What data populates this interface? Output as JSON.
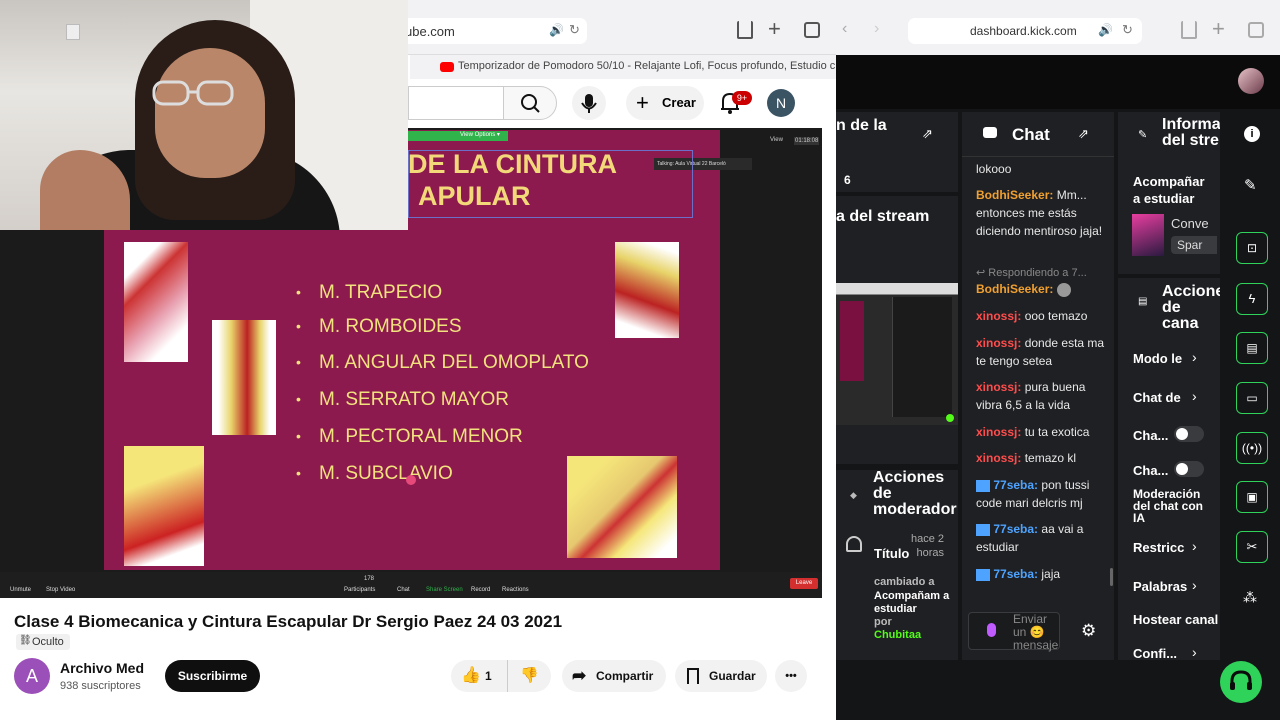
{
  "yt": {
    "url": "ube.com",
    "tab_title": "Temporizador de Pomodoro 50/10 - Relajante Lofi, Focus profundo, Estudio c...",
    "create_label": "Crear",
    "notif_count": "9+",
    "avatar_letter": "N",
    "video_title": "Clase 4 Biomecanica y Cintura Escapular Dr Sergio Paez 24 03 2021",
    "visibility": "Oculto",
    "channel_name": "Archivo Med",
    "channel_avatar_letter": "A",
    "subscribers": "938 suscriptores",
    "subscribe_label": "Suscribirme",
    "like_count": "1",
    "share_label": "Compartir",
    "save_label": "Guardar",
    "more": "•••"
  },
  "slide": {
    "title_line1": "DE LA CINTURA",
    "title_line2": "APULAR",
    "bullets": [
      "M. TRAPECIO",
      "M. ROMBOIDES",
      "M. ANGULAR DEL OMOPLATO",
      "M. SERRATO MAYOR",
      "M. PECTORAL MENOR",
      "M. SUBCLAVIO"
    ],
    "talking_text": "Talking: Aula Virtual 22 Barceló",
    "view_options": "View Options ▾",
    "zoom_controls": [
      "Unmute",
      "Stop Video",
      "Participants",
      "Chat",
      "Share Screen",
      "Record",
      "Reactions"
    ],
    "participants_count": "178",
    "leave_label": "Leave",
    "top_view": "View",
    "timer": "01:18:08"
  },
  "kick": {
    "url": "dashboard.kick.com",
    "panel_left_title": "n de la",
    "panel_left_value": "6",
    "panel_left_title2": "a del stream",
    "chat_title": "Chat",
    "chat_messages": [
      {
        "user": "",
        "text": "lokooo"
      },
      {
        "user": "BodhiSeeker",
        "text": "Mm... entonces me estás diciendo mentiroso jaja!"
      },
      {
        "user": "",
        "text": "Respondiendo a 7..."
      },
      {
        "user": "BodhiSeeker",
        "text": ""
      },
      {
        "user": "xinossj",
        "text": "ooo temazo"
      },
      {
        "user": "xinossj",
        "text": "donde esta ma te tengo setea"
      },
      {
        "user": "xinossj",
        "text": "pura buena vibra 6,5 a la vida"
      },
      {
        "user": "xinossj",
        "text": "tu ta exotica"
      },
      {
        "user": "xinossj",
        "text": "temazo kl"
      },
      {
        "user": "77seba",
        "text": "pon tussi code mari delcris mj"
      },
      {
        "user": "77seba",
        "text": "aa vai a estudiar"
      },
      {
        "user": "77seba",
        "text": "jaja"
      }
    ],
    "send_placeholder": "Enviar un 😊 mensaje",
    "info_title": "Informa del stre",
    "category": "Acompañar a estudiar",
    "conv_label": "Conve",
    "spar_label": "Spar",
    "actions_title": "Accione de cana",
    "action_items": [
      "Modo le",
      "Chat de",
      "Cha...",
      "Cha...",
      "Moderación del chat con IA",
      "Restricc",
      "Palabras",
      "Hostear canal",
      "Confi..."
    ],
    "mod_actions_title": "Acciones de moderador",
    "mod_title_label": "Título",
    "mod_time": "hace 2 horas",
    "mod_changed": "cambiado a",
    "mod_new_value": "Acompañam a estudiar",
    "mod_by": "por",
    "mod_user": "Chubitaa"
  },
  "colors": {
    "kick_green": "#53fc18",
    "slide_bg": "#8c1a4e",
    "slide_text": "#f2e27e",
    "yt_red": "#ff0000"
  }
}
